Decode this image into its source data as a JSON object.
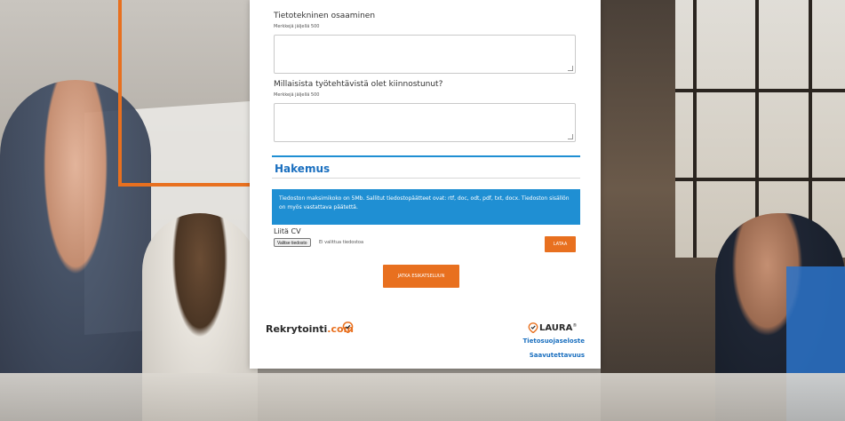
{
  "form": {
    "field1": {
      "label": "Tietotekninen osaaminen",
      "hint": "Merkkejä jäljellä 500"
    },
    "field2": {
      "label": "Millaisista työtehtävistä olet kiinnostunut?",
      "hint": "Merkkejä jäljellä 500"
    },
    "section_title": "Hakemus",
    "info_text": "Tiedoston maksimikoko on 5Mb. Sallitut tiedostopäätteet ovat: rtf, doc, odt, pdf, txt, docx. Tiedoston sisällön on myös vastattava päätettä.",
    "cv_label": "Liitä CV",
    "file_button": "Valitse tiedosto",
    "file_status": "Ei valittua tiedostoa",
    "upload_button": "LATAA",
    "continue_button": "JATKA ESIKATSELUUN"
  },
  "footer": {
    "brand_main": "Rekrytointi",
    "brand_suffix": ".com",
    "brand_tagline": "",
    "laura_logo": "LAURA",
    "laura_tm": "®",
    "privacy_link": "Tietosuojaseloste",
    "accessibility_link": "Saavutettavuus"
  },
  "colors": {
    "accent": "#e8701f",
    "primary": "#1f8fd3",
    "link": "#1a6fbf"
  },
  "icons": [
    "location-pin-check-icon",
    "location-pin-check-icon",
    "resize-grip-icon"
  ]
}
